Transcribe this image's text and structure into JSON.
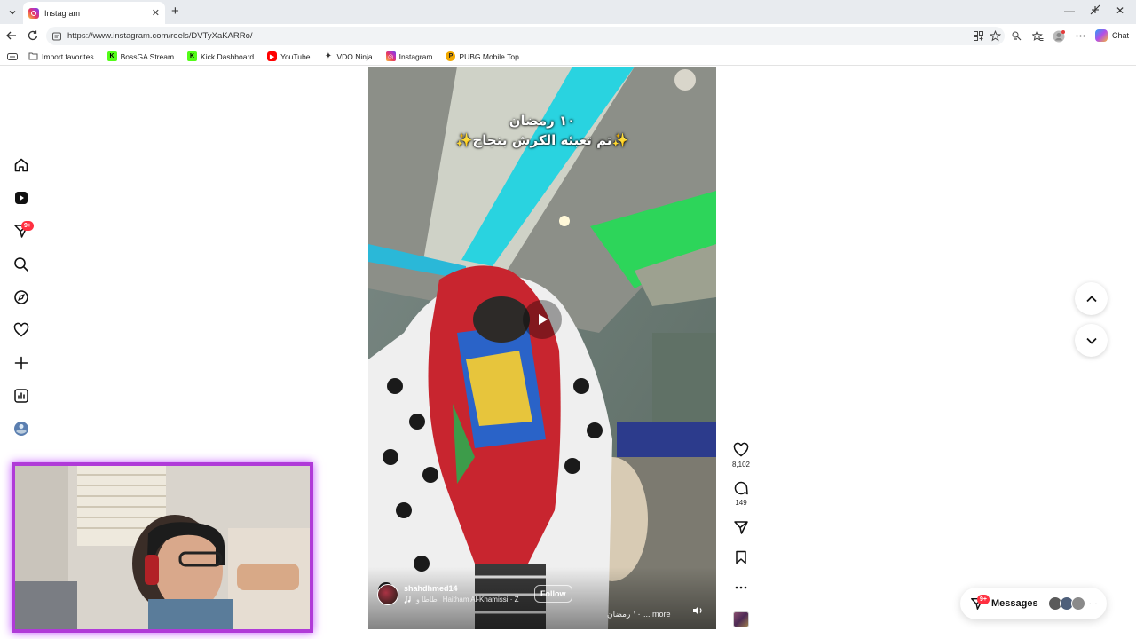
{
  "browser": {
    "tab_title": "Instagram",
    "url": "https://www.instagram.com/reels/DVTyXaKARRo/",
    "chat_label": "Chat",
    "bookmarks": [
      {
        "label": "Import favorites",
        "icon": "import-icon"
      },
      {
        "label": "BossGA Stream",
        "icon": "kick-icon",
        "color": "#53fc18"
      },
      {
        "label": "Kick Dashboard",
        "icon": "kick-icon",
        "color": "#53fc18"
      },
      {
        "label": "YouTube",
        "icon": "youtube-icon",
        "color": "#ff0000"
      },
      {
        "label": "VDO.Ninja",
        "icon": "vdo-ninja-icon"
      },
      {
        "label": "Instagram",
        "icon": "instagram-icon"
      },
      {
        "label": "PUBG Mobile Top...",
        "icon": "pubg-icon",
        "color": "#f2a900"
      }
    ]
  },
  "sidebar": {
    "items": [
      "home-icon",
      "reels-icon",
      "messenger-icon",
      "search-icon",
      "explore-icon",
      "notifications-icon",
      "create-icon",
      "dashboard-icon",
      "profile-avatar"
    ],
    "messages_badge": "9+"
  },
  "reel": {
    "caption_line1": "١٠ رمضان",
    "caption_line2": "✨تم تعبئه الكرش بنجاح✨",
    "author": "shahdhmed14",
    "audio_left": "طاطا و",
    "audio_right": "Haitham Al-Khamissi · Z",
    "follow_label": "Follow",
    "description": "١٠ رمضان ... more",
    "likes": "8,102",
    "comments": "149"
  },
  "messages": {
    "label": "Messages",
    "badge": "9+"
  },
  "colors": {
    "instagram_badge": "#ff3040",
    "webcam_border": "#b03ad8"
  }
}
